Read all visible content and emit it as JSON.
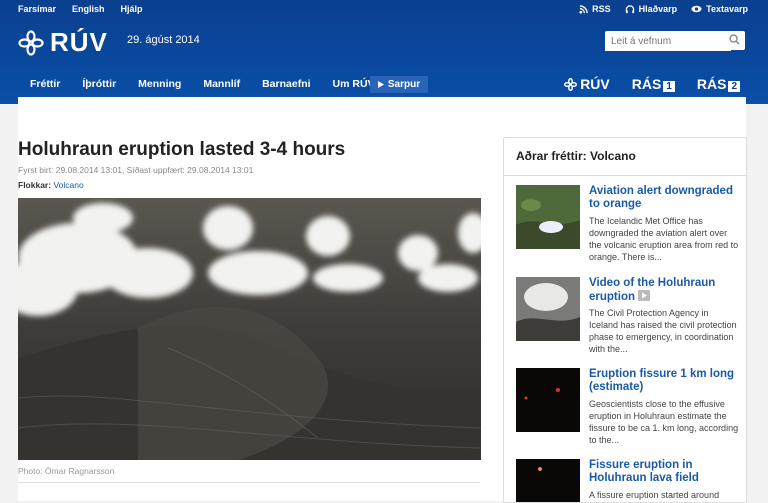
{
  "top_links": [
    "Farsímar",
    "English",
    "Hjálp"
  ],
  "top_right": {
    "rss": "RSS",
    "hladvarp": "Hlaðvarp",
    "textavarp": "Textavarp"
  },
  "logo": "RÚV",
  "date": "29. ágúst 2014",
  "search": {
    "placeholder": "Leit á vefnum"
  },
  "nav": [
    "Fréttir",
    "Íþróttir",
    "Menning",
    "Mannlíf",
    "Barnaefni",
    "Um RÚV"
  ],
  "sarpur": "Sarpur",
  "brands": {
    "ruv": "RÚV",
    "ras": "RÁS",
    "one": "1",
    "two": "2"
  },
  "article": {
    "title": "Holuhraun eruption lasted 3-4 hours",
    "meta": "Fyrst birt: 29.08.2014 13:01, Síðast uppfært: 29.08.2014 13:01",
    "category_label": "Flokkar:",
    "category": "Volcano",
    "caption": "Photo: Ómar Ragnarsson"
  },
  "sidebar": {
    "title": "Aðrar fréttir: Volcano",
    "items": [
      {
        "title": "Aviation alert downgraded to orange",
        "text": "The Icelandic Met Office has downgraded the aviation alert over the volcanic eruption area from red to orange. There is..."
      },
      {
        "title": "Video of the Holuhraun eruption",
        "text": "The Civil Protection Agency in Iceland has raised the civil protection phase to emergency, in coordination with the..."
      },
      {
        "title": "Eruption fissure 1 km long (estimate)",
        "text": "Geoscientists close to the effusive eruption in Holuhraun estimate the fissure to be ca 1. km long, according to the..."
      },
      {
        "title": "Fissure eruption in Holuhraun lava field",
        "text": "A fissure eruption started around"
      }
    ]
  },
  "colors": {
    "header": "#0b3f8f",
    "link": "#1a5aa6"
  }
}
